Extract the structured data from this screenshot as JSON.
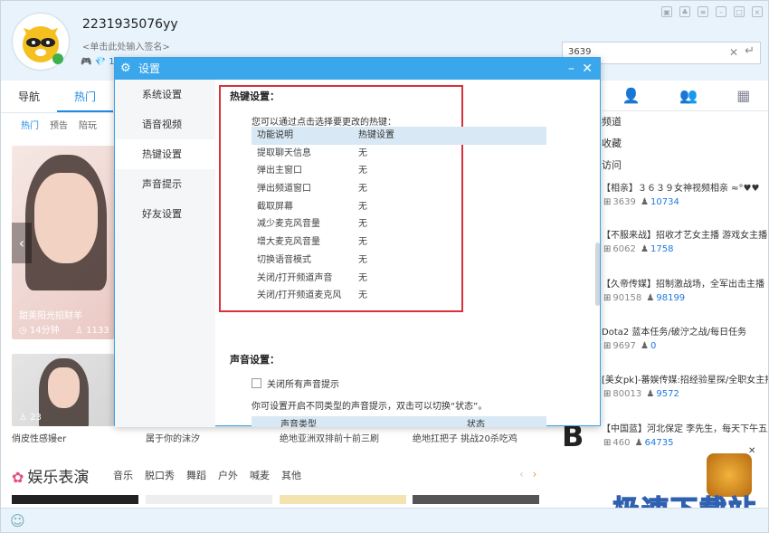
{
  "user": {
    "name": "2231935076yy",
    "signature": "<单击此处输入签名>",
    "status": "1"
  },
  "search": {
    "value": "3639"
  },
  "nav": {
    "tabs": [
      "导航",
      "热门"
    ],
    "subtabs": [
      "热门",
      "预告",
      "陪玩"
    ]
  },
  "cards": [
    {
      "caption": "甜美阳光招财羊",
      "duration": "14分钟",
      "viewers": "1133"
    },
    {
      "caption": "",
      "viewers": "23"
    }
  ],
  "bottom_captions": [
    "俏皮性感嫚er",
    "属于你的沫汐",
    "绝地亚洲双排前十前三刷",
    "绝地扛把子 挑战20杀吃鸡"
  ],
  "section": {
    "title": "娱乐表演",
    "categories": [
      "音乐",
      "脱口秀",
      "舞蹈",
      "户外",
      "喊麦",
      "其他"
    ]
  },
  "right_panel": {
    "links": [
      "频道",
      "收藏",
      "访问"
    ],
    "items": [
      {
        "title": "【相亲】３６３９女神视频相亲 ≈°♥♥",
        "id": "3639",
        "num": "10734"
      },
      {
        "title": "【不服来战】招收才艺女主播 游戏女主播",
        "id": "6062",
        "num": "1758"
      },
      {
        "title": "【久帝传媒】招制激战场，全军出击主播",
        "id": "90158",
        "num": "98199"
      },
      {
        "title": "Dota2 蓝本任务/破泞之战/每日任务",
        "id": "9697",
        "num": "0"
      },
      {
        "title": "[美女pk]-蕃娱传媒:招经验星探/全职女主播",
        "id": "80013",
        "num": "9572"
      },
      {
        "title": "【中国蓝】河北保定 李先生，每天下午五点",
        "id": "460",
        "num": "64735"
      }
    ]
  },
  "watermark": "极速下载站",
  "dialog": {
    "title": "设置",
    "side_items": [
      "系统设置",
      "语音视频",
      "热键设置",
      "声音提示",
      "好友设置"
    ],
    "hotkey": {
      "title": "热键设置：",
      "desc": "您可以通过点击选择要更改的热键：",
      "head": [
        "功能说明",
        "热键设置"
      ],
      "rows": [
        [
          "提取聊天信息",
          "无"
        ],
        [
          "弹出主窗口",
          "无"
        ],
        [
          "弹出频道窗口",
          "无"
        ],
        [
          "截取屏幕",
          "无"
        ],
        [
          "减少麦克风音量",
          "无"
        ],
        [
          "增大麦克风音量",
          "无"
        ],
        [
          "切换语音模式",
          "无"
        ],
        [
          "关闭/打开频道声音",
          "无"
        ],
        [
          "关闭/打开频道麦克风",
          "无"
        ]
      ]
    },
    "sound": {
      "title": "声音设置：",
      "checkbox": "关闭所有声音提示",
      "desc": "你可设置开启不同类型的声音提示，双击可以切换“状态”。",
      "head": [
        "声音类型",
        "状态"
      ]
    }
  }
}
